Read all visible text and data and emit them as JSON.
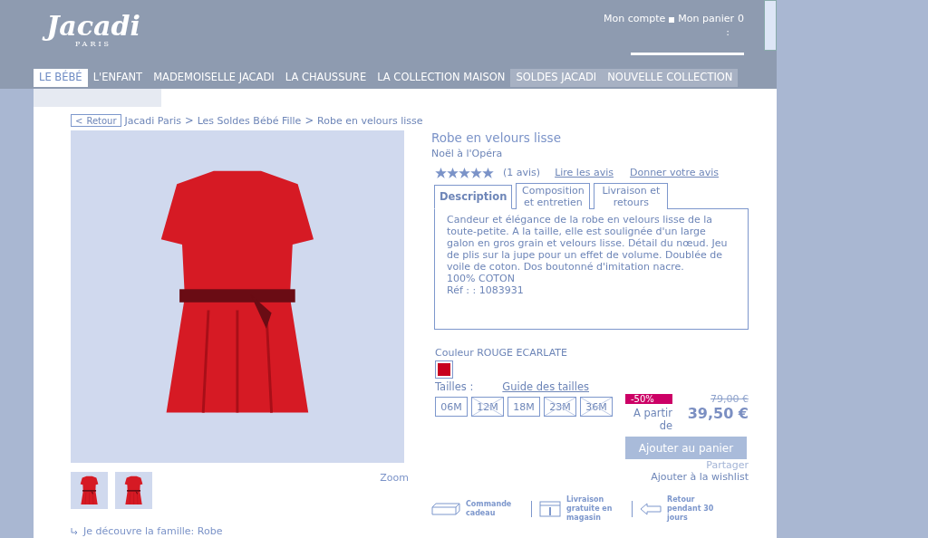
{
  "header": {
    "logo": {
      "name": "Jacadi",
      "tagline": "PARIS"
    },
    "account": "Mon compte",
    "cart": {
      "label": "Mon panier",
      "count": "0",
      "separator": ":"
    }
  },
  "nav": [
    {
      "label": "LE BÉBÉ",
      "selected": true,
      "highlighted": false
    },
    {
      "label": "L'ENFANT",
      "selected": false,
      "highlighted": false
    },
    {
      "label": "MADEMOISELLE JACADI",
      "selected": false,
      "highlighted": false
    },
    {
      "label": "LA CHAUSSURE",
      "selected": false,
      "highlighted": false
    },
    {
      "label": "LA COLLECTION MAISON",
      "selected": false,
      "highlighted": false
    },
    {
      "label": "SOLDES JACADI",
      "selected": false,
      "highlighted": true
    },
    {
      "label": "NOUVELLE COLLECTION",
      "selected": false,
      "highlighted": true
    }
  ],
  "back_button": {
    "arrow": "<",
    "label": "Retour"
  },
  "breadcrumb": [
    "Jacadi Paris",
    "Les Soldes Bébé Fille",
    "Robe en velours lisse"
  ],
  "breadcrumb_separator": ">",
  "gallery": {
    "zoom": "Zoom"
  },
  "family_link": "Je découvre la famille: Robe",
  "product": {
    "title": "Robe en velours lisse",
    "collection": "Noël à l'Opéra",
    "stars": 5,
    "reviews_count": "(1 avis)",
    "read_reviews": "Lire les avis",
    "give_review": "Donner votre avis"
  },
  "tabs": [
    {
      "label": "Description",
      "selected": true
    },
    {
      "label": "Composition et entretien",
      "selected": false
    },
    {
      "label": "Livraison et retours",
      "selected": false
    }
  ],
  "description": {
    "text": "Candeur et élégance de la robe en velours lisse de la toute-petite. A la taille, elle est soulignée d'un large galon en gros grain et velours lisse. Détail du nœud. Jeu de plis sur la jupe pour un effet de volume. Doublée de voile de coton. Dos boutonné d'imitation nacre.",
    "composition": "100% COTON",
    "reference": "Réf : : 1083931"
  },
  "color": {
    "label": "Couleur ROUGE ECARLATE",
    "swatches": [
      {
        "color": "#c8001e",
        "selected": true
      }
    ]
  },
  "sizes": {
    "label": "Tailles :",
    "guide": "Guide des tailles",
    "items": [
      {
        "label": "06M",
        "disabled": false
      },
      {
        "label": "12M",
        "disabled": true
      },
      {
        "label": "18M",
        "disabled": false
      },
      {
        "label": "23M",
        "disabled": true
      },
      {
        "label": "36M",
        "disabled": true
      }
    ]
  },
  "price": {
    "discount": "-50%",
    "old": "79,00 €",
    "from": "A partir de",
    "current": "39,50 €"
  },
  "add_to_cart": "Ajouter au panier",
  "share": "Partager",
  "wishlist": "Ajouter à la wishlist",
  "services": [
    {
      "kind": "gift",
      "label": "Commande cadeau"
    },
    {
      "kind": "store",
      "label": "Livraison gratuite en magasin"
    },
    {
      "kind": "return",
      "label": "Retour pendant 30 jours"
    }
  ]
}
